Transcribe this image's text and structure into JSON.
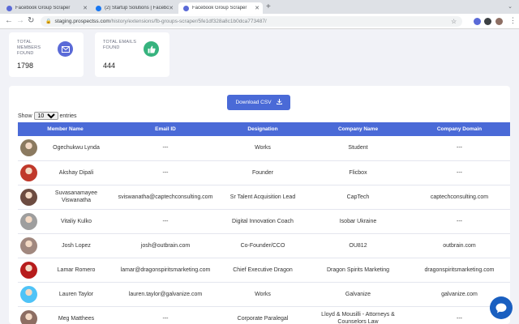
{
  "browser": {
    "tabs": [
      {
        "label": "Facebook Group Scraper",
        "favicon_color": "#5a6ad7",
        "active": false
      },
      {
        "label": "(2) Startup Solutions | Facebo",
        "favicon_color": "#1877f2",
        "active": false
      },
      {
        "label": "Facebook Group Scraper",
        "favicon_color": "#5a6ad7",
        "active": true
      }
    ],
    "new_tab_label": "+",
    "url_host": "staging.prospectss.com",
    "url_path": "/history/extensions/fb-groups-scraper/5fe1df328a8c1b0dca773487/"
  },
  "stats": [
    {
      "label": "TOTAL MEMBERS FOUND",
      "value": "1798",
      "icon": "envelope-icon",
      "color": "#5a6ad7"
    },
    {
      "label": "TOTAL EMAILS FOUND",
      "value": "444",
      "icon": "thumbs-up-icon",
      "color": "#36b37e"
    }
  ],
  "download_button": "Download CSV",
  "show_entries": {
    "before": "Show",
    "value": "10",
    "after": "entries"
  },
  "table": {
    "headers": [
      "Member Name",
      "Email ID",
      "Designation",
      "Company Name",
      "Company Domain"
    ],
    "rows": [
      {
        "name": "Ogechukwu Lynda",
        "email": "---",
        "designation": "Works",
        "company": "Student",
        "domain": "---",
        "avatar_color": "#8b7a60"
      },
      {
        "name": "Akshay Dipali",
        "email": "---",
        "designation": "Founder",
        "company": "Flicbox",
        "domain": "---",
        "avatar_color": "#c0392b"
      },
      {
        "name": "Suvasanamayee Viswanatha",
        "email": "sviswanatha@captechconsulting.com",
        "designation": "Sr Talent Acquisition Lead",
        "company": "CapTech",
        "domain": "captechconsulting.com",
        "avatar_color": "#6d4c41"
      },
      {
        "name": "Vitaliy Kulko",
        "email": "---",
        "designation": "Digital Innovation Coach",
        "company": "Isobar Ukraine",
        "domain": "---",
        "avatar_color": "#9e9e9e"
      },
      {
        "name": "Josh Lopez",
        "email": "josh@outbrain.com",
        "designation": "Co-Founder/CCO",
        "company": "OU812",
        "domain": "outbrain.com",
        "avatar_color": "#a1887f"
      },
      {
        "name": "Lamar Romero",
        "email": "lamar@dragonspiritsmarketing.com",
        "designation": "Chief Executive Dragon",
        "company": "Dragon Spirits Marketing",
        "domain": "dragonspiritsmarketing.com",
        "avatar_color": "#b71c1c"
      },
      {
        "name": "Lauren Taylor",
        "email": "lauren.taylor@galvanize.com",
        "designation": "Works",
        "company": "Galvanize",
        "domain": "galvanize.com",
        "avatar_color": "#4fc3f7"
      },
      {
        "name": "Meg Matthees",
        "email": "---",
        "designation": "Corporate Paralegal",
        "company": "Lloyd & Mousilli - Attorneys & Counselors Law",
        "domain": "---",
        "avatar_color": "#8d6e63"
      }
    ]
  }
}
